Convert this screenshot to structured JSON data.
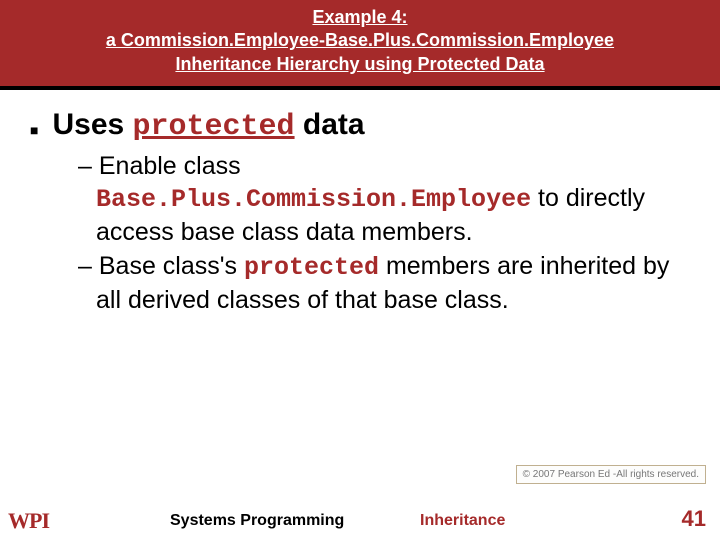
{
  "header": {
    "line1": "Example 4:",
    "line2": "a Commission.Employee-Base.Plus.Commission.Employee",
    "line3": "Inheritance Hierarchy using Protected Data"
  },
  "main": {
    "uses_pre": "Uses ",
    "uses_kw": "protected",
    "uses_post": " data"
  },
  "sub": {
    "item1_a": "Enable class ",
    "item1_kw": "Base.Plus.Commission.Employee",
    "item1_b": " to directly access base class data members.",
    "item2_a": "Base class's ",
    "item2_kw": "protected",
    "item2_b": " members are inherited by all derived classes of that base class."
  },
  "copyright": "© 2007 Pearson Ed -All rights reserved.",
  "footer": {
    "logo": "WPI",
    "center": "Systems Programming",
    "topic": "Inheritance",
    "page": "41"
  }
}
